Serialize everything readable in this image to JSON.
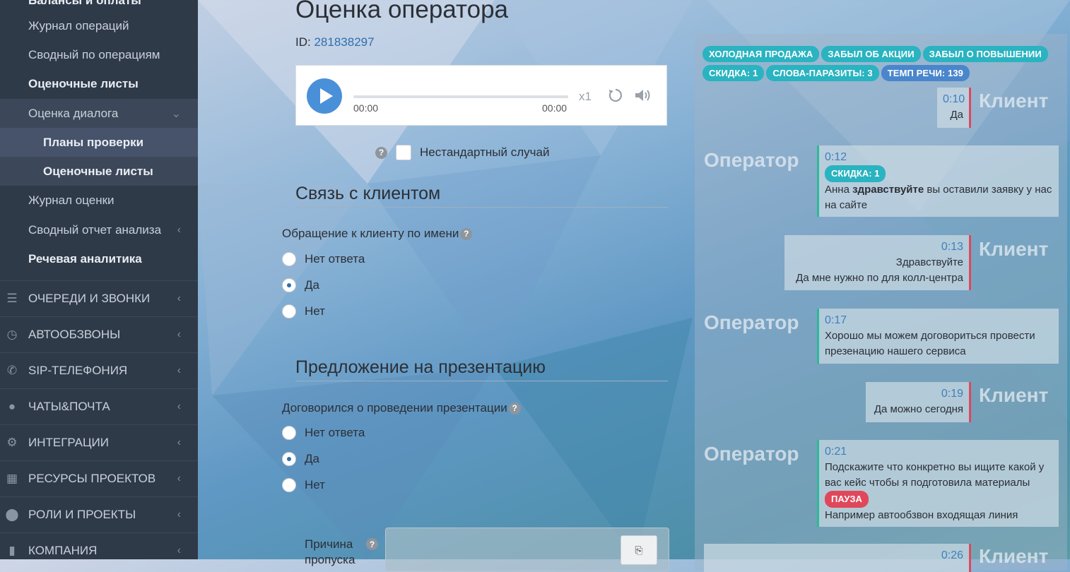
{
  "sidebar": {
    "items": [
      {
        "label": "Балансы и оплаты"
      },
      {
        "label": "Журнал операций"
      },
      {
        "label": "Сводный по операциям"
      },
      {
        "label": "Оценочные листы"
      },
      {
        "label": "Оценка диалога"
      },
      {
        "label": "Планы проверки"
      },
      {
        "label": "Оценочные листы"
      },
      {
        "label": "Журнал оценки"
      },
      {
        "label": "Сводный отчет анализа"
      },
      {
        "label": "Речевая аналитика"
      }
    ],
    "sections": [
      {
        "label": "ОЧЕРЕДИ И ЗВОНКИ",
        "icon": "list-icon"
      },
      {
        "label": "АВТООБЗВОНЫ",
        "icon": "clock-icon"
      },
      {
        "label": "SIP-ТЕЛЕФОНИЯ",
        "icon": "phone-icon"
      },
      {
        "label": "ЧАТЫ&ПОЧТА",
        "icon": "chat-icon"
      },
      {
        "label": "ИНТЕГРАЦИИ",
        "icon": "gears-icon"
      },
      {
        "label": "РЕСУРСЫ ПРОЕКТОВ",
        "icon": "grid-icon"
      },
      {
        "label": "РОЛИ И ПРОЕКТЫ",
        "icon": "toggle-icon"
      },
      {
        "label": "КОМПАНИЯ",
        "icon": "chart-icon"
      }
    ]
  },
  "main": {
    "title": "Оценка оператора",
    "id_label": "ID:",
    "id_value": "281838297",
    "player": {
      "time_start": "00:00",
      "time_end": "00:00",
      "speed": "x1"
    },
    "nonstandard_label": "Нестандартный случай",
    "sections": [
      {
        "title": "Связь с клиентом",
        "question": "Обращение к клиенту по имени",
        "options": [
          "Нет ответа",
          "Да",
          "Нет"
        ],
        "selected": 1
      },
      {
        "title": "Предложение на презентацию",
        "question": "Договорился о проведении презентации",
        "options": [
          "Нет ответа",
          "Да",
          "Нет"
        ],
        "selected": 1
      }
    ],
    "reason_label_line1": "Причина",
    "reason_label_line2": "пропуска"
  },
  "transcript": {
    "tags_row1": [
      "ХОЛОДНАЯ ПРОДАЖА",
      "ЗАБЫЛ ОБ АКЦИИ",
      "ЗАБЫЛ О ПОВЫШЕНИИ"
    ],
    "tags_row2": [
      "СКИДКА: 1",
      "СЛОВА-ПАРАЗИТЫ: 3",
      "ТЕМП РЕЧИ: 139"
    ],
    "client_label": "Клиент",
    "operator_label": "Оператор",
    "messages": [
      {
        "time": "0:10",
        "text": "Да"
      },
      {
        "time": "0:12",
        "tag": "СКИДКА: 1",
        "pre": "Анна ",
        "bold": "здравствуйте",
        "post": " вы оставили заявку у нас на сайте"
      },
      {
        "time": "0:13",
        "line1": "Здравствуйте",
        "line2": "Да мне нужно по для колл-центра"
      },
      {
        "time": "0:17",
        "text": "Хорошо мы можем договориться провести презенацию нашего сервиса"
      },
      {
        "time": "0:19",
        "text": "Да можно сегодня"
      },
      {
        "time": "0:21",
        "text": "Подскажите что конкретно вы ищите какой у вас кейс чтобы я подготовила материалы",
        "tag": "ПАУЗА",
        "text2": "Например автообзвон входящая линия"
      },
      {
        "time": "0:26"
      }
    ]
  }
}
